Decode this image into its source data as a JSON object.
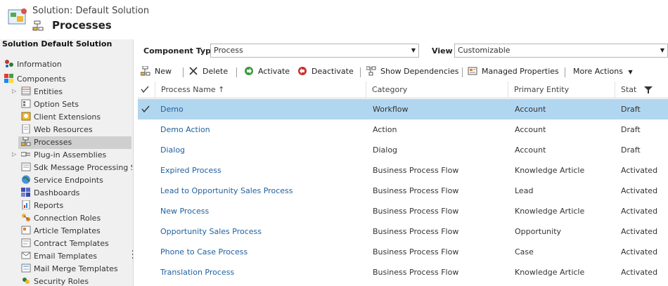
{
  "header": {
    "subtitle": "Solution: Default Solution",
    "title": "Processes"
  },
  "sidebar": {
    "title": "Solution Default Solution",
    "items": [
      {
        "label": "Information",
        "icon": "information-icon"
      },
      {
        "label": "Components",
        "icon": "components-icon"
      },
      {
        "label": "Entities",
        "icon": "entities-icon"
      },
      {
        "label": "Option Sets",
        "icon": "option-sets-icon"
      },
      {
        "label": "Client Extensions",
        "icon": "client-extensions-icon"
      },
      {
        "label": "Web Resources",
        "icon": "web-resources-icon"
      },
      {
        "label": "Processes",
        "icon": "processes-icon"
      },
      {
        "label": "Plug-in Assemblies",
        "icon": "plugin-icon"
      },
      {
        "label": "Sdk Message Processing St...",
        "icon": "sdk-message-icon"
      },
      {
        "label": "Service Endpoints",
        "icon": "globe-icon"
      },
      {
        "label": "Dashboards",
        "icon": "dashboard-icon"
      },
      {
        "label": "Reports",
        "icon": "reports-icon"
      },
      {
        "label": "Connection Roles",
        "icon": "connection-roles-icon"
      },
      {
        "label": "Article Templates",
        "icon": "article-templates-icon"
      },
      {
        "label": "Contract Templates",
        "icon": "contract-templates-icon"
      },
      {
        "label": "Email Templates",
        "icon": "email-templates-icon"
      },
      {
        "label": "Mail Merge Templates",
        "icon": "mail-merge-icon"
      },
      {
        "label": "Security Roles",
        "icon": "security-roles-icon"
      }
    ]
  },
  "filters": {
    "component_type_label": "Component Type",
    "component_type_value": "Process",
    "view_label": "View",
    "view_value": "Customizable"
  },
  "toolbar": {
    "new": "New",
    "delete": "Delete",
    "activate": "Activate",
    "deactivate": "Deactivate",
    "show_dependencies": "Show Dependencies",
    "managed_properties": "Managed Properties",
    "more_actions": "More Actions"
  },
  "grid": {
    "columns": [
      "Process Name ↑",
      "Category",
      "Primary Entity",
      "Stat"
    ],
    "rows": [
      {
        "name": "Demo",
        "category": "Workflow",
        "entity": "Account",
        "status": "Draft"
      },
      {
        "name": "Demo Action",
        "category": "Action",
        "entity": "Account",
        "status": "Draft"
      },
      {
        "name": "Dialog",
        "category": "Dialog",
        "entity": "Account",
        "status": "Draft"
      },
      {
        "name": "Expired Process",
        "category": "Business Process Flow",
        "entity": "Knowledge Article",
        "status": "Activated"
      },
      {
        "name": "Lead to Opportunity Sales Process",
        "category": "Business Process Flow",
        "entity": "Lead",
        "status": "Activated"
      },
      {
        "name": "New Process",
        "category": "Business Process Flow",
        "entity": "Knowledge Article",
        "status": "Activated"
      },
      {
        "name": "Opportunity Sales Process",
        "category": "Business Process Flow",
        "entity": "Opportunity",
        "status": "Activated"
      },
      {
        "name": "Phone to Case Process",
        "category": "Business Process Flow",
        "entity": "Case",
        "status": "Activated"
      },
      {
        "name": "Translation Process",
        "category": "Business Process Flow",
        "entity": "Knowledge Article",
        "status": "Activated"
      }
    ]
  },
  "colors": {
    "selected_row": "#b1d6f0",
    "link": "#1f5f9e",
    "sidebar_bg": "#f0f0f0"
  }
}
